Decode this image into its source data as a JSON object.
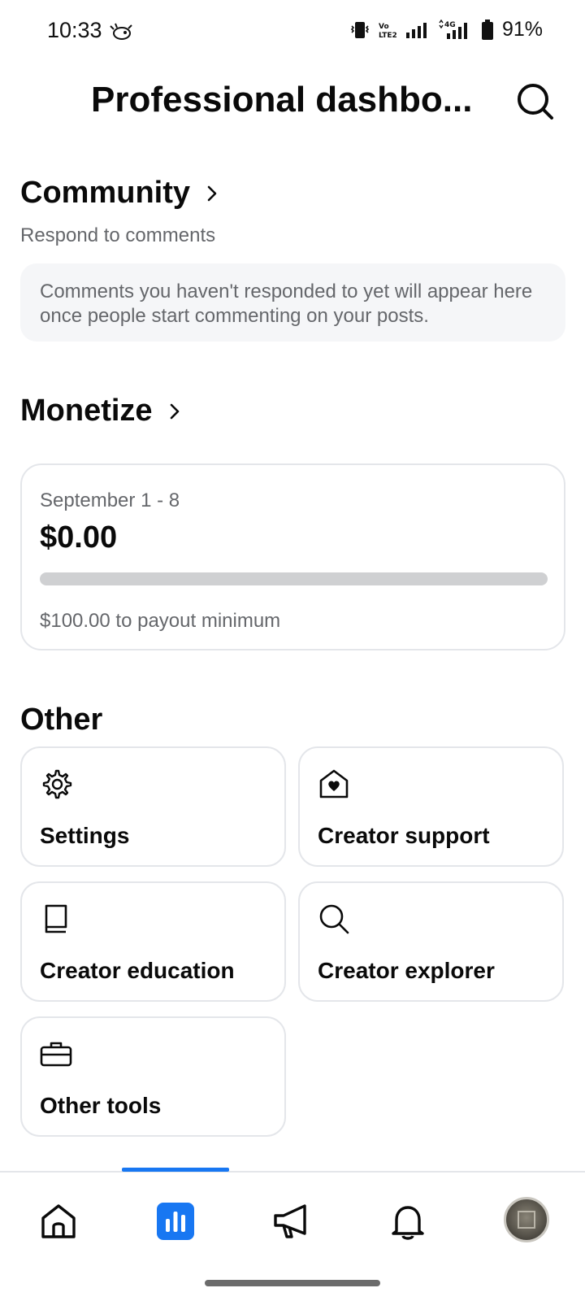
{
  "status_bar": {
    "time": "10:33",
    "battery_percent": "91%",
    "network_label": "4G"
  },
  "header": {
    "title": "Professional dashbo..."
  },
  "community": {
    "title": "Community",
    "subtitle": "Respond to comments",
    "empty_message": "Comments you haven't responded to yet will appear here once people start commenting on your posts."
  },
  "monetize": {
    "title": "Monetize",
    "period": "September 1 - 8",
    "amount": "$0.00",
    "progress_fraction": 0,
    "payout_note": "$100.00 to payout minimum"
  },
  "other": {
    "title": "Other",
    "tiles": [
      {
        "label": "Settings",
        "icon": "gear-icon"
      },
      {
        "label": "Creator support",
        "icon": "heart-house-icon"
      },
      {
        "label": "Creator education",
        "icon": "book-icon"
      },
      {
        "label": "Creator explorer",
        "icon": "search-icon"
      },
      {
        "label": "Other tools",
        "icon": "briefcase-icon"
      }
    ]
  },
  "bottom_nav": {
    "items": [
      {
        "icon": "home-icon",
        "active": false
      },
      {
        "icon": "dashboard-icon",
        "active": true
      },
      {
        "icon": "megaphone-icon",
        "active": false
      },
      {
        "icon": "bell-icon",
        "active": false
      },
      {
        "icon": "profile-avatar",
        "active": false
      }
    ]
  },
  "colors": {
    "accent": "#1877f2",
    "text_primary": "#0a0a0a",
    "text_secondary": "#65676b",
    "card_border": "#e4e6ea",
    "info_bg": "#f5f6f8",
    "progress_track": "#cfd0d2"
  }
}
